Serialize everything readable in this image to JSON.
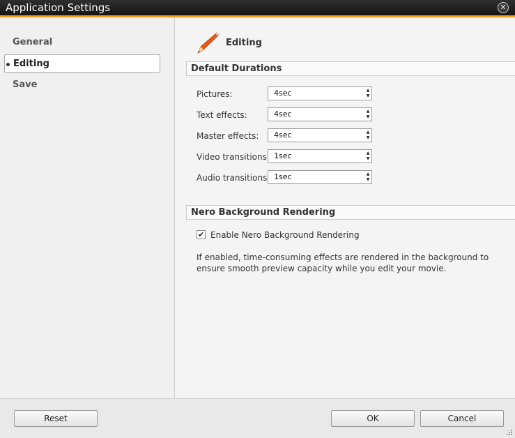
{
  "window": {
    "title": "Application Settings",
    "close_glyph": "✕"
  },
  "sidebar": {
    "items": [
      {
        "label": "General",
        "selected": false
      },
      {
        "label": "Editing",
        "selected": true
      },
      {
        "label": "Save",
        "selected": false
      }
    ]
  },
  "page": {
    "title": "Editing",
    "icon": "pencil-icon"
  },
  "default_durations": {
    "header": "Default Durations",
    "fields": [
      {
        "label": "Pictures:",
        "value": "4sec"
      },
      {
        "label": "Text effects:",
        "value": "4sec"
      },
      {
        "label": "Master effects:",
        "value": "4sec"
      },
      {
        "label": "Video transitions:",
        "value": "1sec"
      },
      {
        "label": "Audio transitions:",
        "value": "1sec"
      }
    ]
  },
  "background_rendering": {
    "header": "Nero Background Rendering",
    "checkbox_label": "Enable Nero Background Rendering",
    "checked": true,
    "description": "If enabled, time-consuming effects are rendered in the background to ensure smooth preview capacity while you edit your movie."
  },
  "footer": {
    "reset_label": "Reset",
    "ok_label": "OK",
    "cancel_label": "Cancel"
  },
  "colors": {
    "accent": "#f0a020",
    "titlebar": "#1e1e1e"
  }
}
